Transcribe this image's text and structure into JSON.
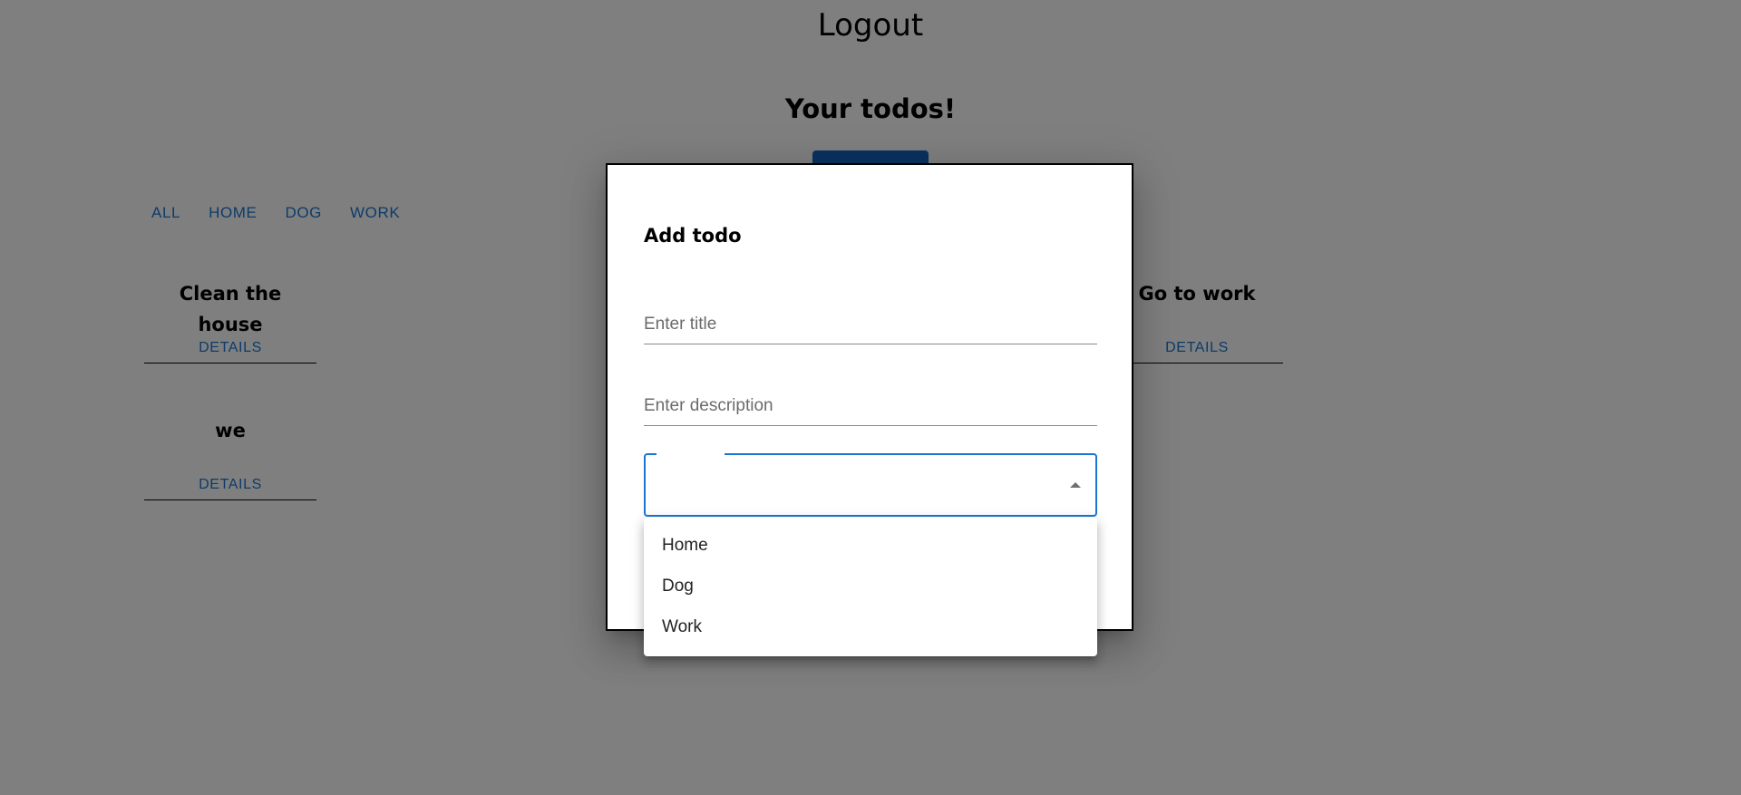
{
  "header": {
    "logout_label": "Logout",
    "title": "Your todos!"
  },
  "filters": [
    {
      "label": "ALL"
    },
    {
      "label": "HOME"
    },
    {
      "label": "DOG"
    },
    {
      "label": "WORK"
    }
  ],
  "todos": [
    {
      "title": "Clean the house",
      "details_label": "DETAILS"
    },
    {
      "title": "we",
      "details_label": "DETAILS"
    },
    {
      "title": "Go to work",
      "details_label": "DETAILS"
    }
  ],
  "modal": {
    "title": "Add todo",
    "title_placeholder": "Enter title",
    "description_placeholder": "Enter description",
    "category_value": "",
    "category_options": [
      "Home",
      "Dog",
      "Work"
    ]
  },
  "colors": {
    "primary": "#1976d2",
    "backdrop": "rgba(0,0,0,0.5)"
  }
}
